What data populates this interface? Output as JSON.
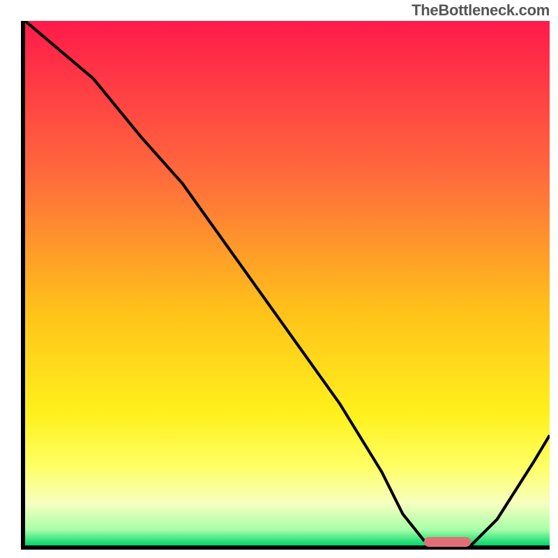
{
  "attribution": "TheBottleneck.com",
  "colors": {
    "axis": "#000000",
    "curve": "#000000",
    "marker": "#e36f76",
    "gradient_top": "#ff1a4a",
    "gradient_30": "#ff6c3c",
    "gradient_55": "#ffc11a",
    "gradient_75": "#fff11c",
    "gradient_85": "#ffff66",
    "gradient_92": "#f6ffc0",
    "gradient_97": "#a8ffa8",
    "gradient_bottom": "#00d56b"
  },
  "chart_data": {
    "type": "line",
    "title": "",
    "xlabel": "",
    "ylabel": "",
    "xlim": [
      0,
      100
    ],
    "ylim": [
      0,
      100
    ],
    "x": [
      0,
      13,
      22,
      30,
      40,
      50,
      60,
      68,
      72,
      76,
      80,
      85,
      90,
      97,
      100
    ],
    "values": [
      100,
      89,
      78,
      69,
      55,
      41,
      27,
      14,
      6,
      1,
      0,
      0,
      5,
      16,
      21
    ],
    "marker": {
      "x_start": 76,
      "x_end": 85,
      "y": 0
    },
    "background_gradient": [
      {
        "pct": 0,
        "color": "#ff1a4a"
      },
      {
        "pct": 30,
        "color": "#ff6c3c"
      },
      {
        "pct": 55,
        "color": "#ffc11a"
      },
      {
        "pct": 75,
        "color": "#fff11c"
      },
      {
        "pct": 85,
        "color": "#ffff66"
      },
      {
        "pct": 92,
        "color": "#f6ffc0"
      },
      {
        "pct": 97,
        "color": "#a8ffa8"
      },
      {
        "pct": 100,
        "color": "#00d56b"
      }
    ]
  }
}
